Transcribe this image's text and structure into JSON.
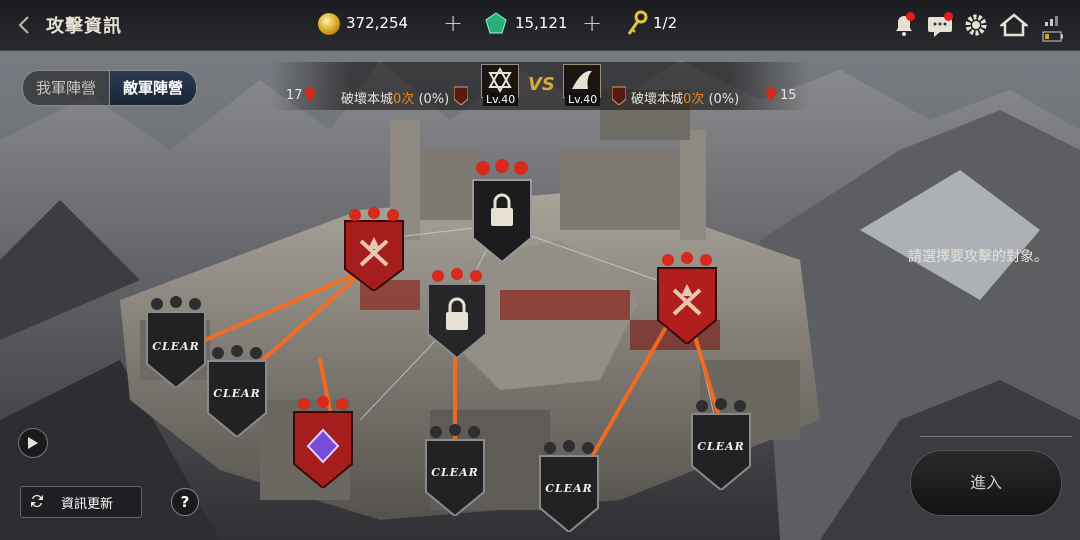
{
  "header": {
    "title": "攻擊資訊",
    "gold": "372,254",
    "gems": "15,121",
    "keys": "1/2",
    "icons": [
      "back-arrow-icon",
      "gold-coin-icon",
      "green-gem-icon",
      "key-icon",
      "bell-icon",
      "chat-icon",
      "gear-icon",
      "home-icon",
      "signal-icon",
      "battery-icon"
    ]
  },
  "tabs": [
    {
      "label": "我軍陣營",
      "active": false
    },
    {
      "label": "敵軍陣營",
      "active": true
    }
  ],
  "versus": {
    "left": {
      "gems": "17",
      "text": "破壞本城",
      "count": "0次",
      "pct": "(0%)",
      "level": "Lv.40"
    },
    "vs": "VS",
    "right": {
      "gems": "15",
      "text": "破壞本城",
      "count": "0次",
      "pct": "(0%)",
      "level": "Lv.40"
    }
  },
  "hint": "請選擇要攻擊的對象。",
  "buttons": {
    "enter": "進入",
    "refresh": "資訊更新",
    "help": "?"
  },
  "nodes": [
    {
      "id": "top-castle",
      "state": "locked",
      "color": "#1c1c1e"
    },
    {
      "id": "left-upper",
      "state": "attackable",
      "color": "#a61d1d"
    },
    {
      "id": "center",
      "state": "locked",
      "color": "#262628"
    },
    {
      "id": "right-upper",
      "state": "attackable",
      "color": "#b21e1e"
    },
    {
      "id": "left-clear-1",
      "state": "clear",
      "label": "CLEAR",
      "color": "#222224"
    },
    {
      "id": "left-clear-2",
      "state": "clear",
      "label": "CLEAR",
      "color": "#222224"
    },
    {
      "id": "purple-red",
      "state": "attackable",
      "color": "#a61d1d"
    },
    {
      "id": "bottom-clear-1",
      "state": "clear",
      "label": "CLEAR",
      "color": "#222224"
    },
    {
      "id": "bottom-clear-2",
      "state": "clear",
      "label": "CLEAR",
      "color": "#222224"
    },
    {
      "id": "right-clear",
      "state": "clear",
      "label": "CLEAR",
      "color": "#222224"
    }
  ]
}
